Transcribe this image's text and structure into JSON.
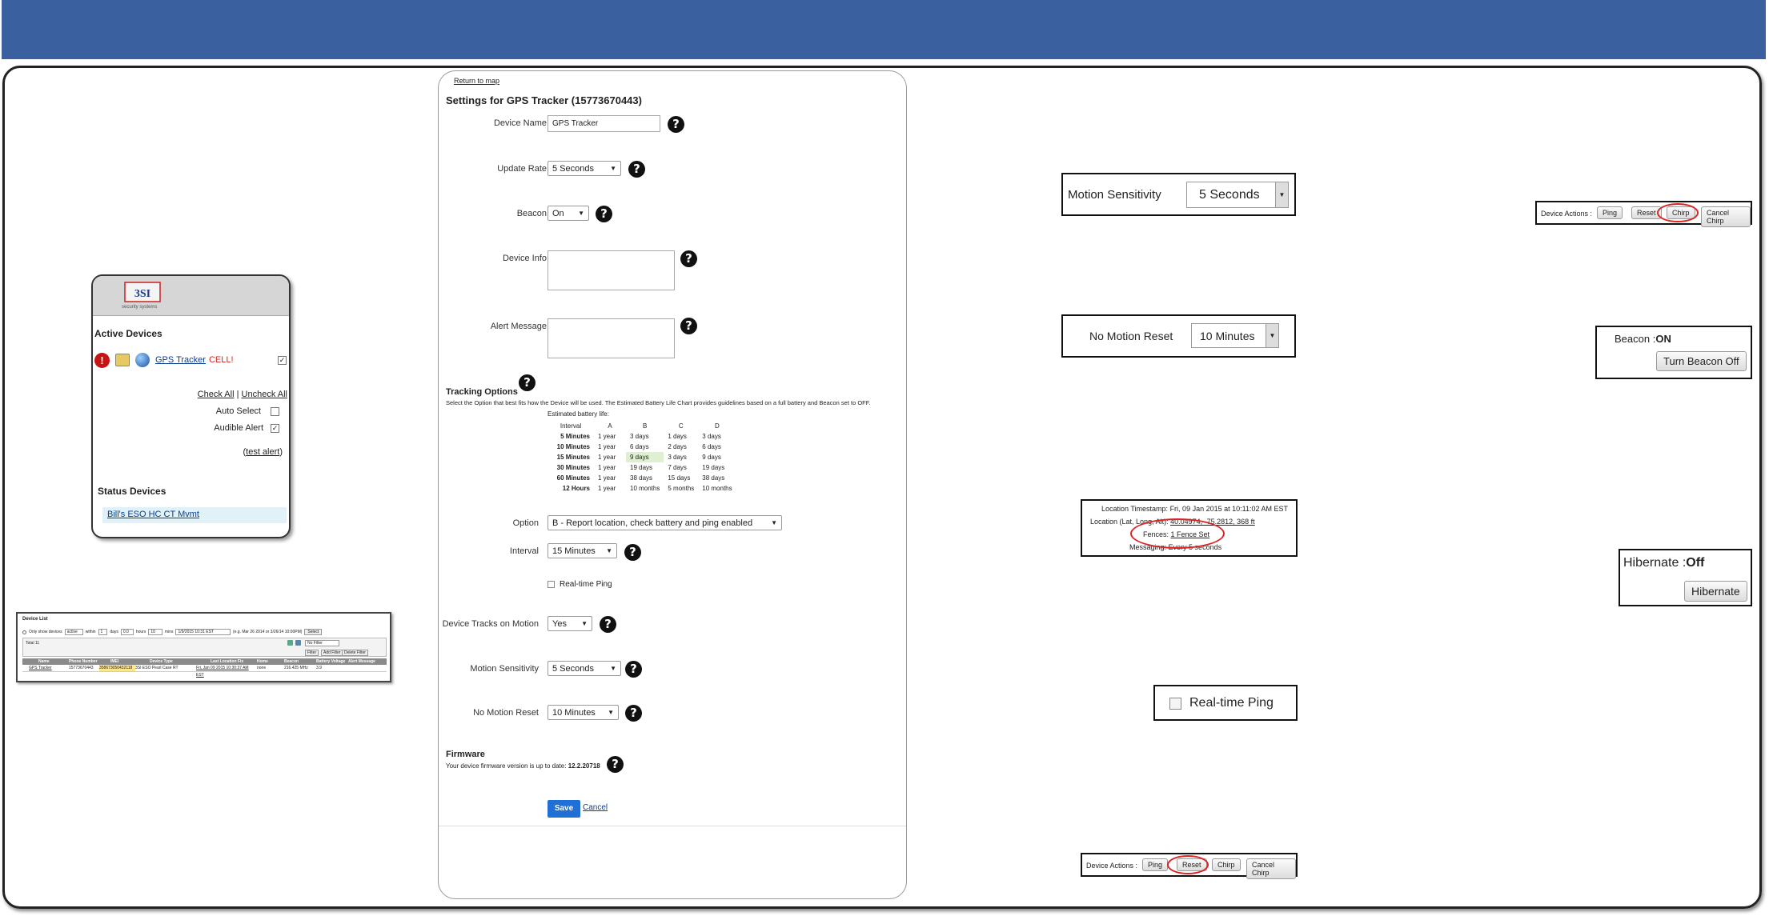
{
  "colors": {
    "banner": "#3a60a0",
    "accent": "#1f6fd6",
    "alert": "#d22222",
    "link": "#0a3d91",
    "highlight": "#e1f1f8"
  },
  "panel_devices": {
    "active_title": "Active Devices",
    "device_name": "GPS Tracker",
    "device_cell": "CELL!",
    "check_all": "Check All",
    "sep": "|",
    "uncheck_all": "Uncheck All",
    "auto_select": "Auto Select",
    "audible_alert": "Audible Alert",
    "test_alert_pre": "(",
    "test_alert": "test alert",
    "test_alert_post": ")",
    "status_title": "Status Devices",
    "status_item": "Bill's ESO HC CT Mvmt",
    "logo_text": "3SI",
    "logo_sub": "security systems"
  },
  "device_list": {
    "title": "Device List",
    "filter_text": "Only show devices",
    "filter_sel": "active",
    "within": "within",
    "days_val": "1",
    "days": "days",
    "hours_val": "0.0",
    "hours": "hours",
    "mins_val": "10",
    "mins": "mins",
    "date_val": "1/9/2015 10:31 EST",
    "eg": "(e.g. Mar 26 2014 or 3/26/14 10:00PM)",
    "select_btn": "Select",
    "total": "Total 11",
    "no_filter": "No Filter",
    "filter_btn": "Filter",
    "add_filter": "Add Filter",
    "delete_filter": "Delete Filter",
    "columns": [
      "Name",
      "Phone Number",
      "IMEI",
      "Device Type",
      "Last Location Fix",
      "Home Location",
      "Beacon Frequency",
      "Battery Voltage",
      "Alert Message"
    ],
    "row": [
      "GPS Tracker",
      "15773670443",
      "358673050432118",
      "3SI ESO Pearl Case RT",
      "Fri, Jan 09 2015 10:30:37 AM EST",
      "none",
      "216.425 MHz",
      "3.9",
      ""
    ]
  },
  "settings": {
    "return": "Return to map",
    "title": "Settings for GPS Tracker (15773670443)",
    "device_name_label": "Device Name",
    "device_name_val": "GPS Tracker",
    "update_rate_label": "Update Rate",
    "update_rate_val": "5 Seconds",
    "beacon_label": "Beacon",
    "beacon_val": "On",
    "device_info_label": "Device Info",
    "alert_msg_label": "Alert Message",
    "tracking_title": "Tracking Options",
    "tracking_desc": "Select the Option that best fits how the Device will be used. The Estimated Battery Life Chart provides guidelines based on a full battery and Beacon set to OFF.",
    "est_label": "Estimated battery life:",
    "table_headers": [
      "Interval",
      "A",
      "B",
      "C",
      "D"
    ],
    "table_rows": [
      [
        "5 Minutes",
        "1 year",
        "3 days",
        "1 days",
        "3 days"
      ],
      [
        "10 Minutes",
        "1 year",
        "6 days",
        "2 days",
        "6 days"
      ],
      [
        "15 Minutes",
        "1 year",
        "9 days",
        "3 days",
        "9 days"
      ],
      [
        "30 Minutes",
        "1 year",
        "19 days",
        "7 days",
        "19 days"
      ],
      [
        "60 Minutes",
        "1 year",
        "38 days",
        "15 days",
        "38 days"
      ],
      [
        "12 Hours",
        "1 year",
        "10 months",
        "5 months",
        "10 months"
      ]
    ],
    "option_label": "Option",
    "option_val": "B - Report location, check battery and ping enabled",
    "interval_label": "Interval",
    "interval_val": "15 Minutes",
    "realtime_label": "Real-time Ping",
    "tracks_motion_label": "Device Tracks on Motion",
    "tracks_motion_val": "Yes",
    "motion_sens_label": "Motion Sensitivity",
    "motion_sens_val": "5 Seconds",
    "no_motion_label": "No Motion Reset",
    "no_motion_val": "10 Minutes",
    "firmware_title": "Firmware",
    "firmware_text": "Your device firmware version is up to date:",
    "firmware_ver": "12.2.20718",
    "save": "Save",
    "cancel": "Cancel"
  },
  "callouts": {
    "motion_sens_label": "Motion Sensitivity",
    "motion_sens_val": "5 Seconds",
    "no_motion_label": "No Motion Reset",
    "no_motion_val": "10 Minutes",
    "loc_timestamp_label": "Location Timestamp:",
    "loc_timestamp_val": "Fri, 09 Jan 2015 at 10:11:02 AM EST",
    "loc_label": "Location (Lat, Long, Alt):",
    "loc_val": "40.04974, -75.2812, 368 ft",
    "fences_label": "Fences:",
    "fences_val": "1 Fence Set",
    "messaging_label": "Messaging:",
    "messaging_val": "Every 5 seconds",
    "realtime_label": "Real-time Ping",
    "actions_label": "Device Actions :",
    "ping": "Ping",
    "reset": "Reset",
    "chirp": "Chirp",
    "cancel_chirp": "Cancel Chirp",
    "beacon_label": "Beacon :",
    "beacon_val": "ON",
    "beacon_btn": "Turn Beacon Off",
    "hibernate_label": "Hibernate :",
    "hibernate_val": "Off",
    "hibernate_btn": "Hibernate"
  },
  "icons": [
    "alert-icon",
    "tracker-device-icon",
    "globe-icon",
    "question-icon",
    "dropdown-arrow-icon",
    "checkbox-icon",
    "logo-icon",
    "search-icon"
  ]
}
